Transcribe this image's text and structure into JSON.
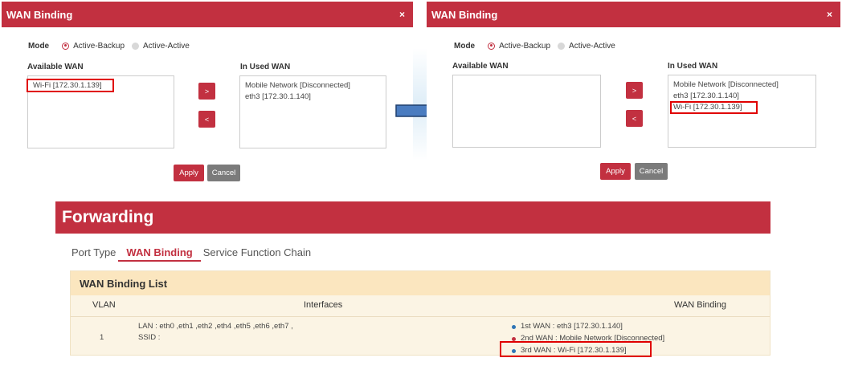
{
  "left_dialog": {
    "title": "WAN Binding",
    "close": "×",
    "mode_label": "Mode",
    "mode_options": [
      "Active-Backup",
      "Active-Active"
    ],
    "available_title": "Available WAN",
    "in_used_title": "In Used WAN",
    "available_items": [
      "Wi-Fi [172.30.1.139]"
    ],
    "in_used_items": [
      "Mobile Network [Disconnected]",
      "eth3 [172.30.1.140]"
    ],
    "move_right": ">",
    "move_left": "<",
    "apply": "Apply",
    "cancel": "Cancel"
  },
  "right_dialog": {
    "title": "WAN Binding",
    "close": "×",
    "mode_label": "Mode",
    "mode_options": [
      "Active-Backup",
      "Active-Active"
    ],
    "available_title": "Available WAN",
    "in_used_title": "In Used WAN",
    "available_items": [],
    "in_used_items": [
      "Mobile Network [Disconnected]",
      "eth3 [172.30.1.140]",
      "Wi-Fi [172.30.1.139]"
    ],
    "move_right": ">",
    "move_left": "<",
    "apply": "Apply",
    "cancel": "Cancel"
  },
  "forwarding": {
    "title": "Forwarding",
    "tabs": [
      "Port Type",
      "WAN Binding",
      "Service Function Chain"
    ],
    "active_tab": "WAN Binding",
    "list_title": "WAN Binding List",
    "columns": [
      "VLAN",
      "Interfaces",
      "WAN Binding"
    ],
    "rows": [
      {
        "vlan": "1",
        "lan": "LAN : eth0 ,eth1 ,eth2 ,eth4 ,eth5 ,eth6 ,eth7 ,",
        "ssid": "SSID :",
        "bindings": [
          {
            "text": "1st WAN :  eth3 [172.30.1.140]",
            "color": "#2e74b5"
          },
          {
            "text": "2nd WAN :  Mobile Network [Disconnected]",
            "color": "#c23040"
          },
          {
            "text": "3rd WAN :  Wi-Fi [172.30.1.139]",
            "color": "#2e74b5"
          }
        ]
      }
    ]
  },
  "colors": {
    "accent": "#c23040",
    "highlight": "#e00000",
    "arrow": "#4a7cc0"
  }
}
